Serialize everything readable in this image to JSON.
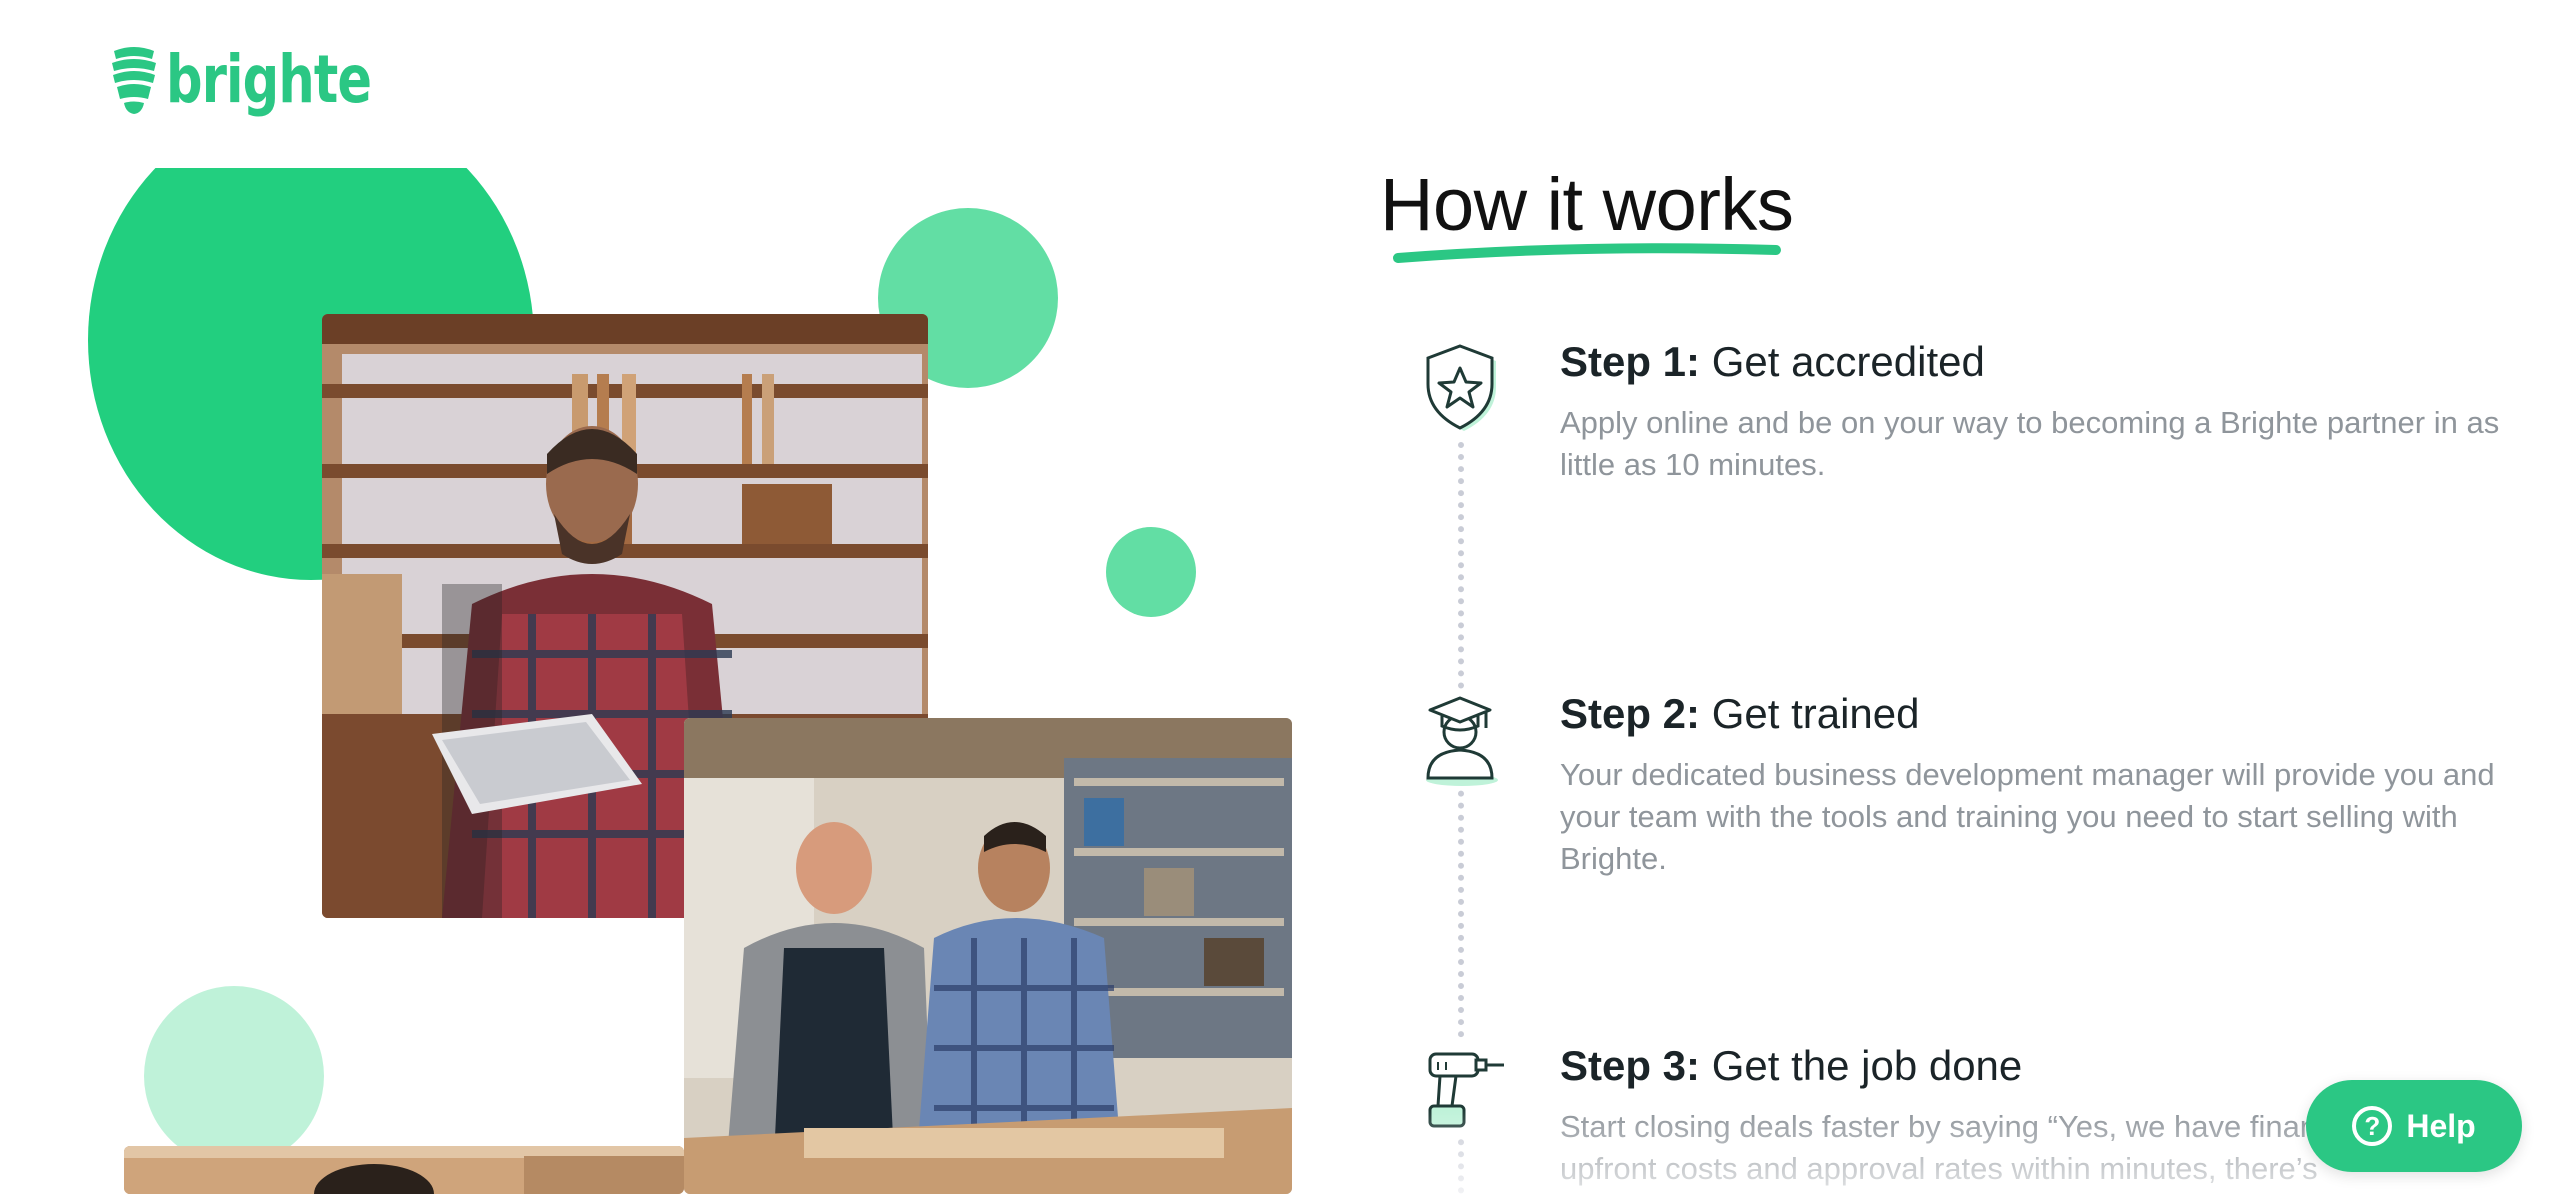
{
  "brand": {
    "name": "brighte",
    "color": "#2bc784"
  },
  "section": {
    "title": "How it works"
  },
  "steps": [
    {
      "number": "Step 1:",
      "title": "Get accredited",
      "description": "Apply online and be on your way to becoming a Brighte partner in as little as 10 minutes.",
      "icon": "shield-star-icon"
    },
    {
      "number": "Step 2:",
      "title": "Get trained",
      "description": "Your dedicated business development manager will provide you and your team with the tools and training you need to start selling with Brighte.",
      "icon": "graduate-icon"
    },
    {
      "number": "Step 3:",
      "title": "Get the job done",
      "description": "Start closing deals faster by saying “Yes, we have finance.” With $0 upfront costs and approval rates within minutes, there’s",
      "icon": "drill-icon"
    }
  ],
  "help": {
    "label": "Help",
    "icon": "question-circle-icon"
  },
  "colors": {
    "accent": "#22cf7f",
    "accent_light": "#62dea4",
    "accent_pale": "#bff2d9",
    "text_muted": "#8f959b"
  }
}
